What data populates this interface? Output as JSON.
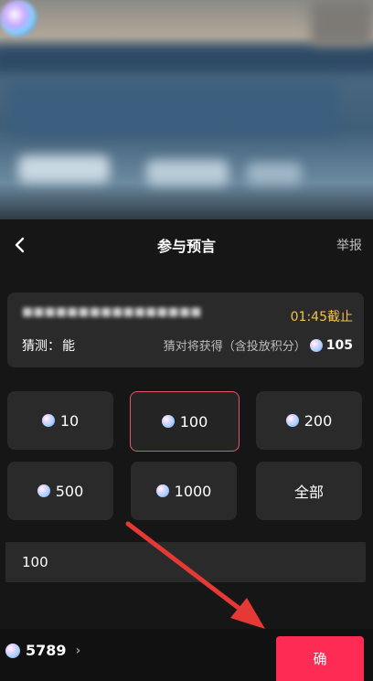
{
  "sheet": {
    "title": "参与预言",
    "report_label": "举报"
  },
  "info": {
    "deadline": "01:45截止",
    "guess_label": "猜测：",
    "guess_value": "能",
    "reward_label": "猜对将获得（含投放积分）",
    "reward_amount": "105"
  },
  "options": [
    {
      "label": "10",
      "icon": "gem-icon"
    },
    {
      "label": "100",
      "icon": "gem-icon",
      "selected": true
    },
    {
      "label": "200",
      "icon": "gem-icon"
    },
    {
      "label": "500",
      "icon": "gem-icon"
    },
    {
      "label": "1000",
      "icon": "gem-icon"
    },
    {
      "label": "全部"
    }
  ],
  "amount_input": {
    "value": "100"
  },
  "footer": {
    "balance": "5789",
    "confirm_label": "确"
  },
  "colors": {
    "accent": "#fe2c55",
    "deadline": "#f5c34a",
    "selected_border": "#e1576b",
    "annotation_arrow": "#e53935"
  }
}
